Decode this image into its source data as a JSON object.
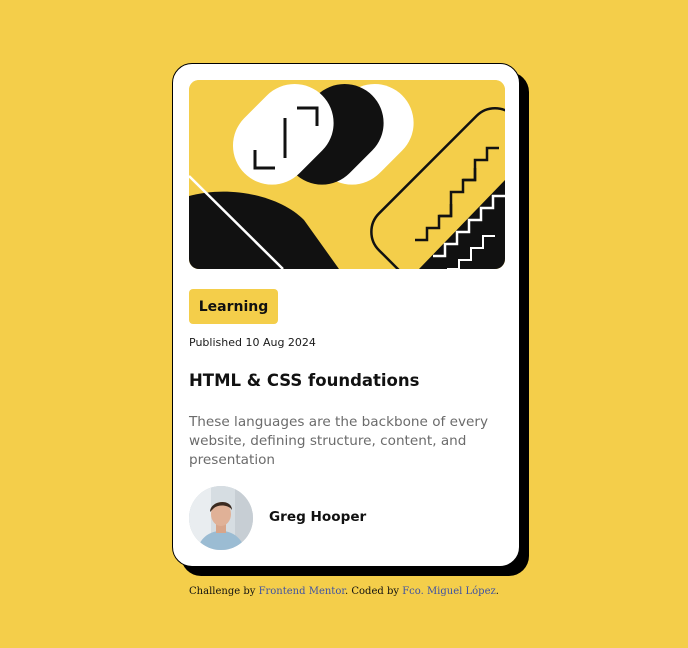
{
  "card": {
    "image_alt": "Illustration article",
    "tag": "Learning",
    "published": "Published 10 Aug 2024",
    "title": "HTML & CSS foundations",
    "description": "These languages are the backbone of every website, defining structure, content, and presentation",
    "author": {
      "name": "Greg Hooper",
      "avatar_icon": "person-avatar"
    }
  },
  "attribution": {
    "prefix": "Challenge by ",
    "challenge_link": "Frontend Mentor",
    "middle": ". Coded by ",
    "author_link": "Fco. Miguel López",
    "suffix": "."
  },
  "colors": {
    "background": "#F4CE4A",
    "card": "#FFFFFF",
    "accent": "#F4CE4A",
    "text": "#111111",
    "muted_text": "#6B6B6B",
    "link": "#3E52A3"
  }
}
